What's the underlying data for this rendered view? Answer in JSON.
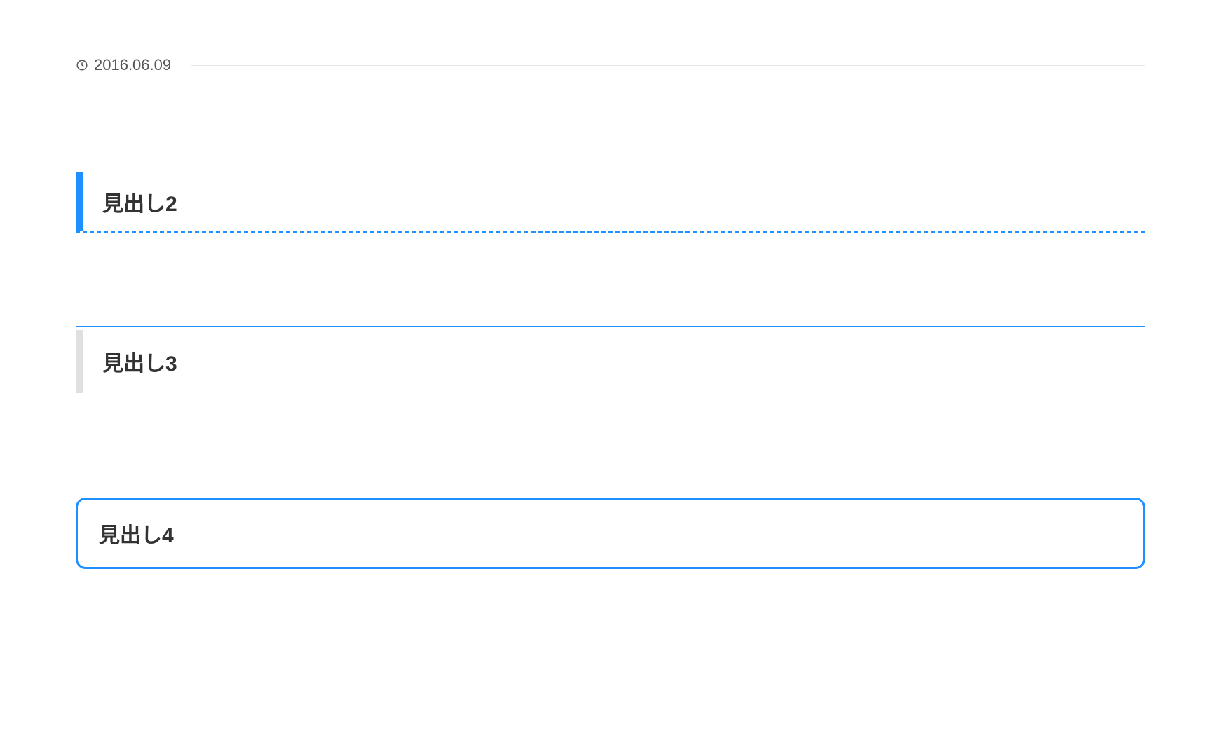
{
  "meta": {
    "date": "2016.06.09"
  },
  "headings": {
    "h2": "見出し2",
    "h3": "見出し3",
    "h4": "見出し4"
  }
}
